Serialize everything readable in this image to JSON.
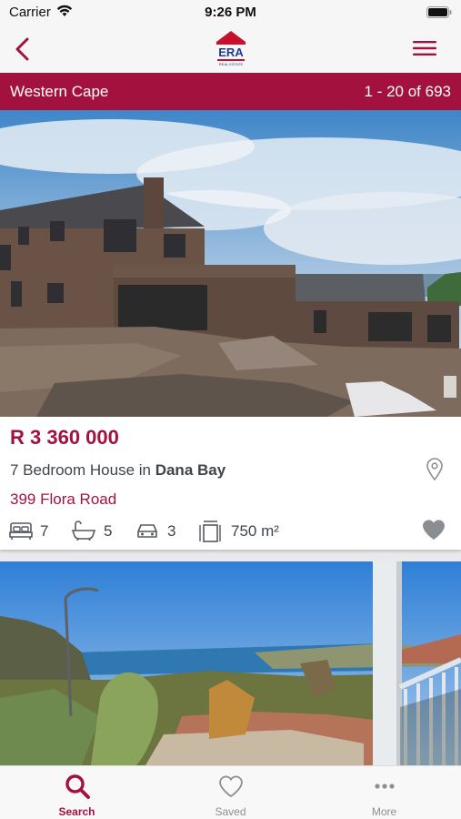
{
  "status_bar": {
    "carrier": "Carrier",
    "time": "9:26 PM"
  },
  "nav": {
    "logo_text": "ERA",
    "logo_subtext": "REAL ESTATE"
  },
  "region_bar": {
    "region": "Western Cape",
    "count": "1 - 20 of 693"
  },
  "listings": [
    {
      "price": "R 3 360 000",
      "desc_prefix": "7 Bedroom House in ",
      "suburb": "Dana Bay",
      "address": "399 Flora Road",
      "bedrooms": "7",
      "bathrooms": "5",
      "garages": "3",
      "floor_area": "750 m²"
    }
  ],
  "tabs": [
    {
      "label": "Search",
      "icon": "search-icon",
      "active": true
    },
    {
      "label": "Saved",
      "icon": "heart-icon",
      "active": false
    },
    {
      "label": "More",
      "icon": "more-icon",
      "active": false
    }
  ],
  "colors": {
    "brand": "#a3123f",
    "inactive_tab": "#8e8e93"
  }
}
